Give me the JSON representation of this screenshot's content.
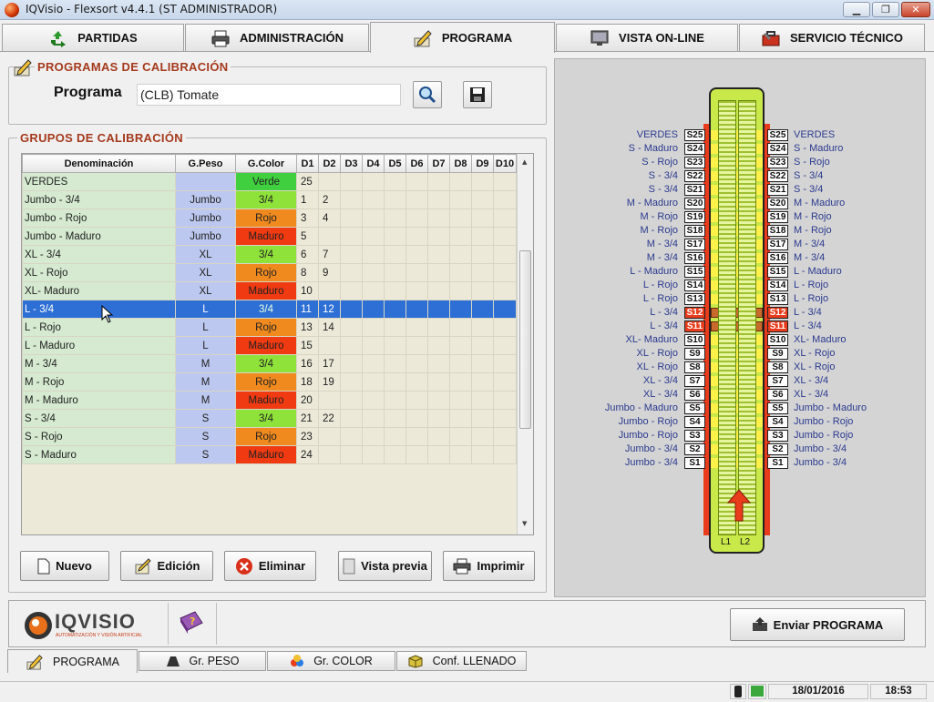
{
  "window": {
    "title": "IQVisio - Flexsort v4.4.1  (ST ADMINISTRADOR)",
    "min_icon": "minimize-icon",
    "max_icon": "maximize-icon",
    "close_icon": "close-icon"
  },
  "tabs": [
    {
      "label": "PARTIDAS",
      "icon": "recycle-icon"
    },
    {
      "label": "ADMINISTRACIÓN",
      "icon": "printer-icon"
    },
    {
      "label": "PROGRAMA",
      "icon": "pencil-icon"
    },
    {
      "label": "VISTA ON-LINE",
      "icon": "monitor-icon"
    },
    {
      "label": "SERVICIO TÉCNICO",
      "icon": "toolbox-icon"
    }
  ],
  "programas": {
    "title": "PROGRAMAS DE CALIBRACIÓN",
    "label": "Programa",
    "value": "(CLB) Tomate"
  },
  "grupos": {
    "title": "GRUPOS DE CALIBRACIÓN",
    "headers": [
      "Denominación",
      "G.Peso",
      "G.Color",
      "D1",
      "D2",
      "D3",
      "D4",
      "D5",
      "D6",
      "D7",
      "D8",
      "D9",
      "D10"
    ],
    "rows": [
      {
        "den": "VERDES",
        "peso": "",
        "color": "Verde",
        "color_hex": "#3fcf3f",
        "d1": "25",
        "d2": ""
      },
      {
        "den": "Jumbo - 3/4",
        "peso": "Jumbo",
        "color": "3/4",
        "color_hex": "#8fe23a",
        "d1": "1",
        "d2": "2"
      },
      {
        "den": "Jumbo - Rojo",
        "peso": "Jumbo",
        "color": "Rojo",
        "color_hex": "#f08a1e",
        "d1": "3",
        "d2": "4"
      },
      {
        "den": "Jumbo - Maduro",
        "peso": "Jumbo",
        "color": "Maduro",
        "color_hex": "#ef3a12",
        "d1": "5",
        "d2": ""
      },
      {
        "den": "XL - 3/4",
        "peso": "XL",
        "color": "3/4",
        "color_hex": "#8fe23a",
        "d1": "6",
        "d2": "7"
      },
      {
        "den": "XL - Rojo",
        "peso": "XL",
        "color": "Rojo",
        "color_hex": "#f08a1e",
        "d1": "8",
        "d2": "9"
      },
      {
        "den": "XL- Maduro",
        "peso": "XL",
        "color": "Maduro",
        "color_hex": "#ef3a12",
        "d1": "10",
        "d2": ""
      },
      {
        "den": "L - 3/4",
        "peso": "L",
        "color": "3/4",
        "color_hex": "#8fe23a",
        "d1": "11",
        "d2": "12",
        "selected": true
      },
      {
        "den": "L - Rojo",
        "peso": "L",
        "color": "Rojo",
        "color_hex": "#f08a1e",
        "d1": "13",
        "d2": "14"
      },
      {
        "den": "L - Maduro",
        "peso": "L",
        "color": "Maduro",
        "color_hex": "#ef3a12",
        "d1": "15",
        "d2": ""
      },
      {
        "den": "M - 3/4",
        "peso": "M",
        "color": "3/4",
        "color_hex": "#8fe23a",
        "d1": "16",
        "d2": "17"
      },
      {
        "den": "M - Rojo",
        "peso": "M",
        "color": "Rojo",
        "color_hex": "#f08a1e",
        "d1": "18",
        "d2": "19"
      },
      {
        "den": "M - Maduro",
        "peso": "M",
        "color": "Maduro",
        "color_hex": "#ef3a12",
        "d1": "20",
        "d2": ""
      },
      {
        "den": "S - 3/4",
        "peso": "S",
        "color": "3/4",
        "color_hex": "#8fe23a",
        "d1": "21",
        "d2": "22"
      },
      {
        "den": "S - Rojo",
        "peso": "S",
        "color": "Rojo",
        "color_hex": "#f08a1e",
        "d1": "23",
        "d2": ""
      },
      {
        "den": "S - Maduro",
        "peso": "S",
        "color": "Maduro",
        "color_hex": "#ef3a12",
        "d1": "24",
        "d2": ""
      }
    ]
  },
  "buttons": {
    "nuevo": "Nuevo",
    "edicion": "Edición",
    "eliminar": "Eliminar",
    "vista_previa": "Vista previa",
    "imprimir": "Imprimir",
    "enviar": "Enviar PROGRAMA"
  },
  "machine": {
    "outputs": [
      {
        "slot": "S25",
        "left": "VERDES",
        "right": "VERDES"
      },
      {
        "slot": "S24",
        "left": "S - Maduro",
        "right": "S - Maduro"
      },
      {
        "slot": "S23",
        "left": "S - Rojo",
        "right": "S - Rojo"
      },
      {
        "slot": "S22",
        "left": "S - 3/4",
        "right": "S - 3/4"
      },
      {
        "slot": "S21",
        "left": "S - 3/4",
        "right": "S - 3/4"
      },
      {
        "slot": "S20",
        "left": "M - Maduro",
        "right": "M - Maduro"
      },
      {
        "slot": "S19",
        "left": "M - Rojo",
        "right": "M - Rojo"
      },
      {
        "slot": "S18",
        "left": "M - Rojo",
        "right": "M - Rojo"
      },
      {
        "slot": "S17",
        "left": "M - 3/4",
        "right": "M - 3/4"
      },
      {
        "slot": "S16",
        "left": "M - 3/4",
        "right": "M - 3/4"
      },
      {
        "slot": "S15",
        "left": "L - Maduro",
        "right": "L - Maduro"
      },
      {
        "slot": "S14",
        "left": "L - Rojo",
        "right": "L - Rojo"
      },
      {
        "slot": "S13",
        "left": "L - Rojo",
        "right": "L - Rojo"
      },
      {
        "slot": "S12",
        "left": "L - 3/4",
        "right": "L - 3/4",
        "highlight": true
      },
      {
        "slot": "S11",
        "left": "L - 3/4",
        "right": "L - 3/4",
        "highlight": true
      },
      {
        "slot": "S10",
        "left": "XL- Maduro",
        "right": "XL- Maduro"
      },
      {
        "slot": "S9",
        "left": "XL - Rojo",
        "right": "XL - Rojo"
      },
      {
        "slot": "S8",
        "left": "XL - Rojo",
        "right": "XL - Rojo"
      },
      {
        "slot": "S7",
        "left": "XL - 3/4",
        "right": "XL - 3/4"
      },
      {
        "slot": "S6",
        "left": "XL - 3/4",
        "right": "XL - 3/4"
      },
      {
        "slot": "S5",
        "left": "Jumbo - Maduro",
        "right": "Jumbo - Maduro"
      },
      {
        "slot": "S4",
        "left": "Jumbo - Rojo",
        "right": "Jumbo - Rojo"
      },
      {
        "slot": "S3",
        "left": "Jumbo - Rojo",
        "right": "Jumbo - Rojo"
      },
      {
        "slot": "S2",
        "left": "Jumbo - 3/4",
        "right": "Jumbo - 3/4"
      },
      {
        "slot": "S1",
        "left": "Jumbo - 3/4",
        "right": "Jumbo - 3/4"
      }
    ],
    "lanes": [
      "L1",
      "L2"
    ]
  },
  "logo": {
    "text": "IQVISIO",
    "tagline": "AUTOMATIZACIÓN Y VISIÓN ARTIFICIAL"
  },
  "subtabs": [
    {
      "label": "PROGRAMA",
      "icon": "pencil-icon"
    },
    {
      "label": "Gr. PESO",
      "icon": "weight-icon"
    },
    {
      "label": "Gr. COLOR",
      "icon": "color-palette-icon"
    },
    {
      "label": "Conf. LLENADO",
      "icon": "box-icon"
    }
  ],
  "status": {
    "date": "18/01/2016",
    "time": "18:53"
  }
}
